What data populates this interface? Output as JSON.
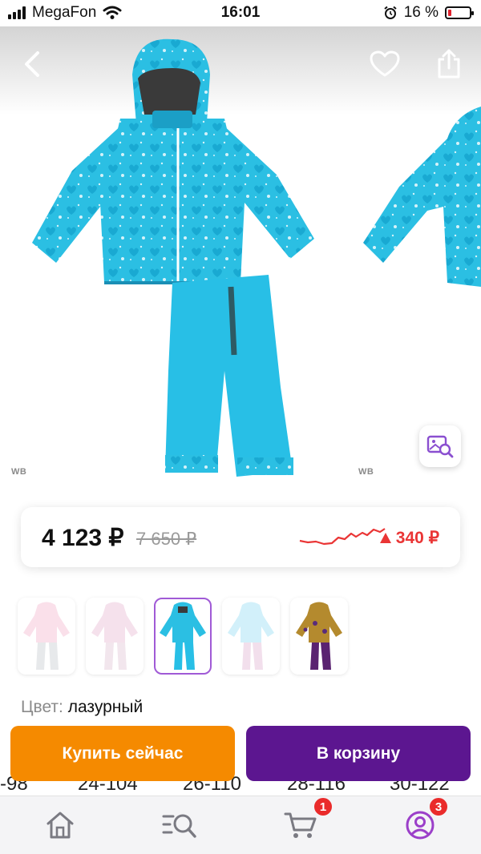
{
  "status_bar": {
    "carrier": "MegaFon",
    "time": "16:01",
    "battery_text": "16 %",
    "battery_level": 0.16,
    "icons": [
      "signal-icon",
      "wifi-icon",
      "alarm-icon",
      "battery-icon"
    ]
  },
  "gallery": {
    "watermark": "WB",
    "watermark_next": "WB",
    "icons": [
      "back-arrow-icon",
      "heart-icon",
      "share-icon",
      "image-search-icon"
    ]
  },
  "price": {
    "current": "4 123 ₽",
    "old": "7 650 ₽",
    "change": "340 ₽",
    "change_direction": "up",
    "accent_color": "#ea3535"
  },
  "colors": {
    "label": "Цвет:",
    "selected": "лазурный",
    "variants": [
      "pink",
      "light-pink",
      "azure",
      "light-blue",
      "purple-leopard"
    ],
    "selected_index": 2
  },
  "sizes": [
    "-98",
    "24-104",
    "26-110",
    "28-116",
    "30-122"
  ],
  "actions": {
    "buy_now": "Купить сейчас",
    "add_to_cart": "В корзину",
    "buy_color": "#f58a00",
    "cart_color": "#5c1690"
  },
  "bottom_nav": {
    "items": [
      "home-icon",
      "catalog-search-icon",
      "cart-icon",
      "profile-icon"
    ],
    "cart_badge": "1",
    "profile_badge": "3"
  }
}
